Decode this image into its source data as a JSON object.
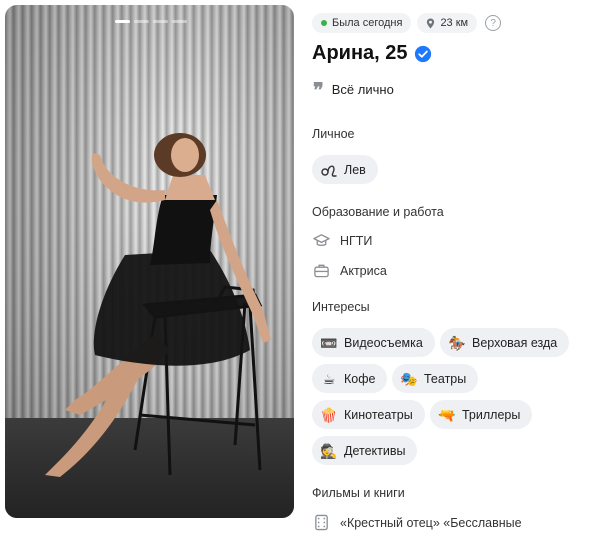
{
  "photo": {
    "pages_total": 4,
    "page_active": 1
  },
  "status": {
    "online_label": "Была сегодня",
    "distance_label": "23 км",
    "help_symbol": "?"
  },
  "profile": {
    "name_age": "Арина, 25",
    "bio": "Всё лично"
  },
  "sections": {
    "personal_title": "Личное",
    "education_title": "Образование и работа",
    "interests_title": "Интересы",
    "films_title": "Фильмы и книги"
  },
  "personal": {
    "zodiac": "Лев",
    "zodiac_icon": "leo-icon"
  },
  "education": {
    "school": "НГТИ",
    "job": "Актриса"
  },
  "interests": [
    {
      "label": "Видеосъемка",
      "icon": "📼"
    },
    {
      "label": "Верховая езда",
      "icon": "🏇"
    },
    {
      "label": "Кофе",
      "icon": "☕"
    },
    {
      "label": "Театры",
      "icon": "🎭"
    },
    {
      "label": "Кинотеатры",
      "icon": "🍿"
    },
    {
      "label": "Триллеры",
      "icon": "🔫"
    },
    {
      "label": "Детективы",
      "icon": "🕵"
    }
  ],
  "films": {
    "text": "«Крестный отец» «Бесславные"
  },
  "colors": {
    "accent": "#1e78ff",
    "online": "#36b24a",
    "chip_bg": "#eef0f3"
  }
}
